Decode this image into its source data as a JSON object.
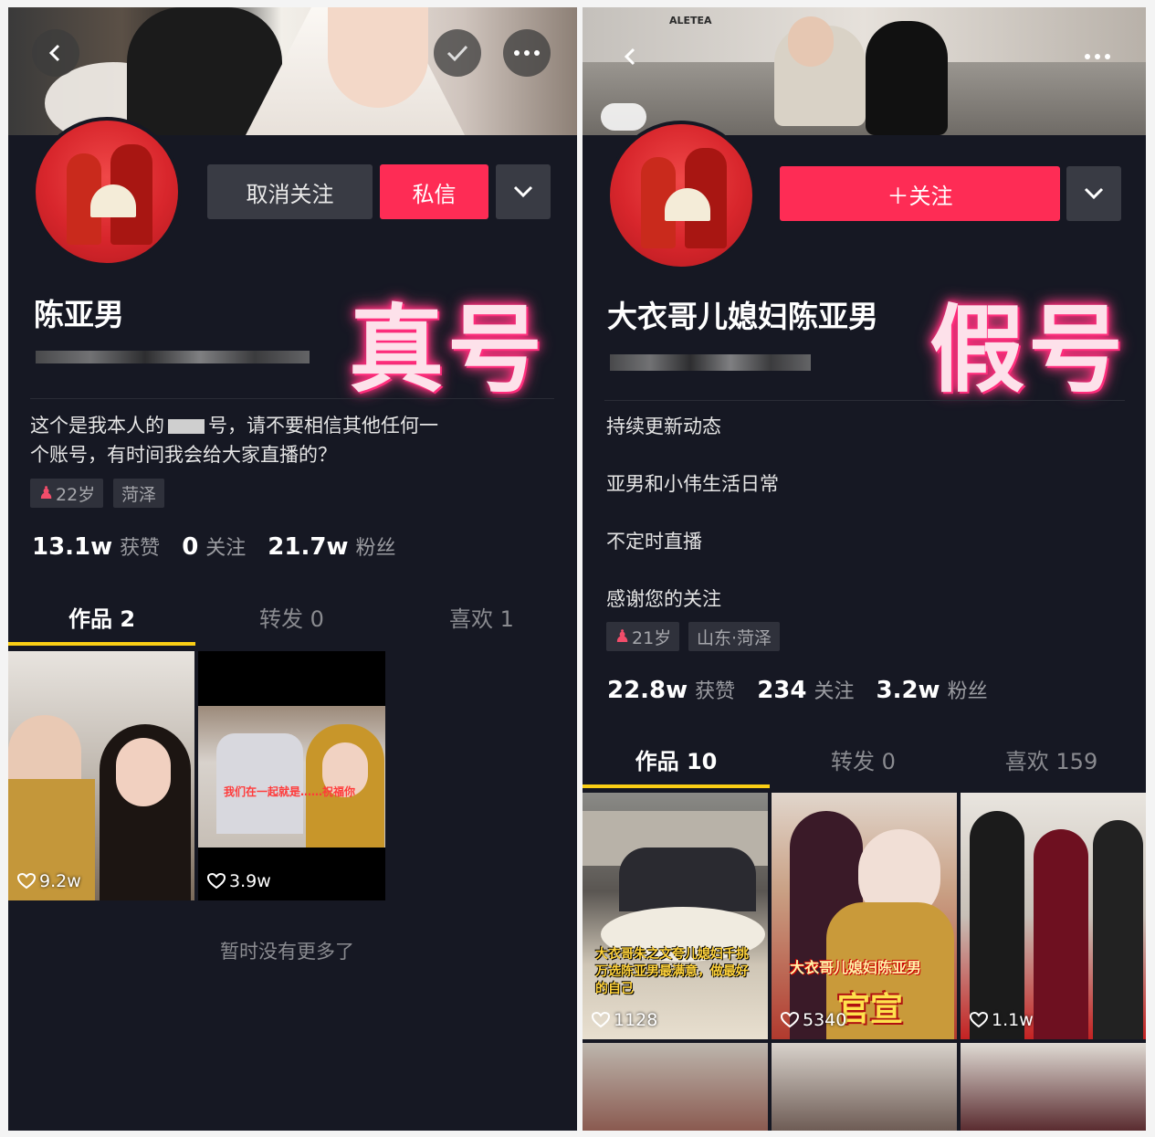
{
  "real": {
    "stamp": "真号",
    "name": "陈亚男",
    "follow_state": "取消关注",
    "message": "私信",
    "bio_line1_a": "这个是我本人的",
    "bio_line1_b": "号，请不要相信其他任何一",
    "bio_line2": "个账号，有时间我会给大家直播的？",
    "age": "22岁",
    "location": "菏泽",
    "stats": {
      "likes_num": "13.1w",
      "likes_lbl": "获赞",
      "following_num": "0",
      "following_lbl": "关注",
      "fans_num": "21.7w",
      "fans_lbl": "粉丝"
    },
    "tabs": {
      "works": "作品 2",
      "reposts": "转发 0",
      "liked": "喜欢 1"
    },
    "videos": [
      {
        "likes": "9.2w"
      },
      {
        "likes": "3.9w"
      }
    ],
    "video2_caption": "我们在一起就是……祝福你",
    "no_more": "暂时没有更多了"
  },
  "fake": {
    "stamp": "假号",
    "name": "大衣哥儿媳妇陈亚男",
    "follow": "＋关注",
    "bio": [
      "持续更新动态",
      "亚男和小伟生活日常",
      "不定时直播",
      "感谢您的关注"
    ],
    "age": "21岁",
    "location": "山东·菏泽",
    "stats": {
      "likes_num": "22.8w",
      "likes_lbl": "获赞",
      "following_num": "234",
      "following_lbl": "关注",
      "fans_num": "3.2w",
      "fans_lbl": "粉丝"
    },
    "tabs": {
      "works": "作品 10",
      "reposts": "转发 0",
      "liked": "喜欢 159"
    },
    "videos": [
      {
        "likes": "1128",
        "caption": "大衣哥朱之文夸儿媳妇千挑万选陈亚男最满意，做最好的自己"
      },
      {
        "likes": "5340",
        "caption": "大衣哥儿媳妇陈亚男",
        "caption2": "官宣"
      },
      {
        "likes": "1.1w"
      }
    ],
    "banner_sign": "ALETEA"
  },
  "colors": {
    "bg": "#161823",
    "accent": "#fe2c55",
    "tab_underline": "#face15",
    "stamp_glow": "#ff2a7a"
  },
  "icons": [
    "back-icon",
    "check-icon",
    "more-icon",
    "chevron-down-icon",
    "heart-icon",
    "female-icon",
    "plus-icon"
  ]
}
